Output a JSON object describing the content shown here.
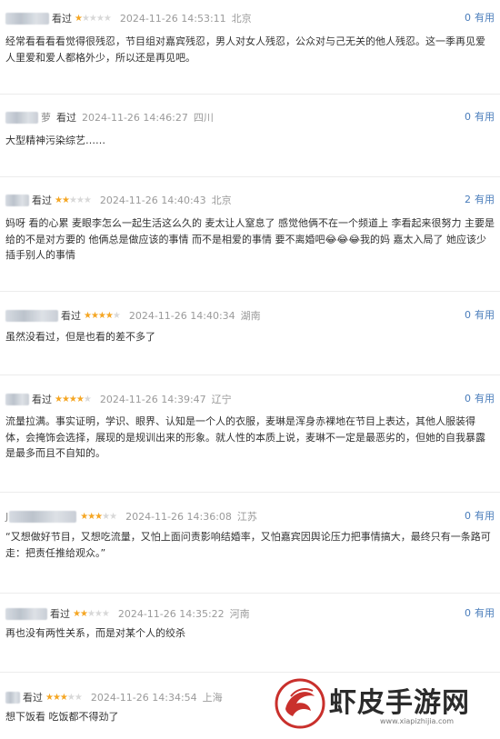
{
  "useful_label": "有用",
  "comments": [
    {
      "user_prefix": "",
      "user_suffix": "",
      "watched": "看过",
      "rating": 1,
      "time": "2024-11-26 14:53:11",
      "location": "北京",
      "useful": "0",
      "text": "经常看看看看觉得很残忍，节目组对嘉宾残忍，男人对女人残忍，公众对与己无关的他人残忍。这一季再见爱人里爱和爱人都格外少，所以还是再见吧。"
    },
    {
      "user_prefix": "",
      "user_suffix": "萝",
      "watched": "看过",
      "rating": 0,
      "time": "2024-11-26 14:46:27",
      "location": "四川",
      "useful": "0",
      "text": "大型精神污染综艺……"
    },
    {
      "user_prefix": "",
      "user_suffix": "",
      "watched": "看过",
      "rating": 2,
      "time": "2024-11-26 14:40:43",
      "location": "北京",
      "useful": "2",
      "text": "妈呀 看的心累 麦眼李怎么一起生活这么久的 麦太让人窒息了 感觉他俩不在一个频道上 李看起来很努力 主要是给的不是对方要的 他俩总是做应该的事情 而不是相爱的事情 要不离婚吧😂😂😂我的妈 嘉太入局了 她应该少插手别人的事情"
    },
    {
      "user_prefix": "",
      "user_suffix": "",
      "watched": "看过",
      "rating": 4,
      "time": "2024-11-26 14:40:34",
      "location": "湖南",
      "useful": "0",
      "text": "虽然没看过，但是也看的差不多了"
    },
    {
      "user_prefix": "",
      "user_suffix": "",
      "watched": "看过",
      "rating": 4,
      "time": "2024-11-26 14:39:47",
      "location": "辽宁",
      "useful": "0",
      "text": "流量拉满。事实证明，学识、眼界、认知是一个人的衣服，麦琳是浑身赤裸地在节目上表达，其他人服装得体，会掩饰会选择，展现的是规训出来的形象。就人性的本质上说，麦琳不一定是最恶劣的，但她的自我暴露是最多而且不自知的。"
    },
    {
      "user_prefix": "J",
      "user_suffix": "",
      "watched": "",
      "rating": 3,
      "time": "2024-11-26 14:36:08",
      "location": "江苏",
      "useful": "0",
      "text": "“又想做好节目，又想吃流量，又怕上面问责影响结婚率，又怕嘉宾因舆论压力把事情搞大，最终只有一条路可走：把责任推给观众。”"
    },
    {
      "user_prefix": "",
      "user_suffix": "",
      "watched": "看过",
      "rating": 2,
      "time": "2024-11-26 14:35:22",
      "location": "河南",
      "useful": "0",
      "text": "再也没有两性关系，而是对某个人的绞杀"
    },
    {
      "user_prefix": "",
      "user_suffix": "",
      "watched": "看过",
      "rating": 3,
      "time": "2024-11-26 14:34:54",
      "location": "上海",
      "useful": "",
      "text": "想下饭看 吃饭都不得劲了"
    }
  ],
  "watermark": {
    "name": "虾皮手游网",
    "url": "www.xiapizhijia.com"
  }
}
